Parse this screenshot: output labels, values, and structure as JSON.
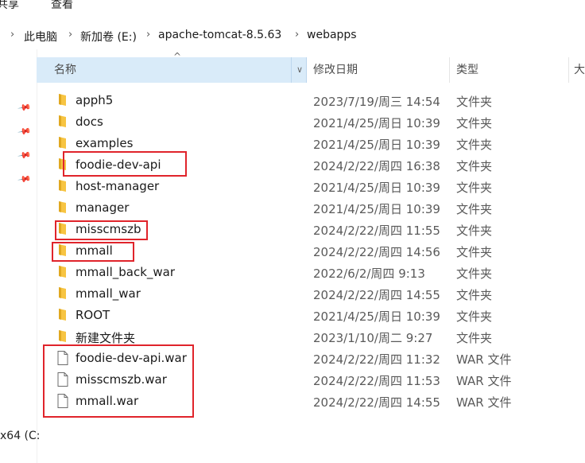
{
  "ribbon": {
    "tabs": [
      "共享",
      "查看"
    ]
  },
  "breadcrumb": {
    "items": [
      "此电脑",
      "新加卷 (E:)",
      "apache-tomcat-8.5.63",
      "webapps"
    ]
  },
  "nav": {
    "label": "x64 (C:"
  },
  "columns": {
    "name": "名称",
    "date": "修改日期",
    "type": "类型",
    "size": "大"
  },
  "files": [
    {
      "name": "apph5",
      "date": "2023/7/19/周三 14:54",
      "type": "文件夹",
      "kind": "folder"
    },
    {
      "name": "docs",
      "date": "2021/4/25/周日 10:39",
      "type": "文件夹",
      "kind": "folder"
    },
    {
      "name": "examples",
      "date": "2021/4/25/周日 10:39",
      "type": "文件夹",
      "kind": "folder"
    },
    {
      "name": "foodie-dev-api",
      "date": "2024/2/22/周四 16:38",
      "type": "文件夹",
      "kind": "folder"
    },
    {
      "name": "host-manager",
      "date": "2021/4/25/周日 10:39",
      "type": "文件夹",
      "kind": "folder"
    },
    {
      "name": "manager",
      "date": "2021/4/25/周日 10:39",
      "type": "文件夹",
      "kind": "folder"
    },
    {
      "name": "misscmszb",
      "date": "2024/2/22/周四 11:55",
      "type": "文件夹",
      "kind": "folder"
    },
    {
      "name": "mmall",
      "date": "2024/2/22/周四 14:56",
      "type": "文件夹",
      "kind": "folder"
    },
    {
      "name": "mmall_back_war",
      "date": "2022/6/2/周四 9:13",
      "type": "文件夹",
      "kind": "folder"
    },
    {
      "name": "mmall_war",
      "date": "2024/2/22/周四 14:55",
      "type": "文件夹",
      "kind": "folder"
    },
    {
      "name": "ROOT",
      "date": "2021/4/25/周日 10:39",
      "type": "文件夹",
      "kind": "folder"
    },
    {
      "name": "新建文件夹",
      "date": "2023/1/10/周二 9:27",
      "type": "文件夹",
      "kind": "folder"
    },
    {
      "name": "foodie-dev-api.war",
      "date": "2024/2/22/周四 11:32",
      "type": "WAR 文件",
      "kind": "file"
    },
    {
      "name": "misscmszb.war",
      "date": "2024/2/22/周四 11:53",
      "type": "WAR 文件",
      "kind": "file"
    },
    {
      "name": "mmall.war",
      "date": "2024/2/22/周四 14:55",
      "type": "WAR 文件",
      "kind": "file"
    }
  ],
  "icons": {
    "folder": "folder-icon",
    "file": "file-icon",
    "pin": "pin-icon",
    "chevron": "chevron-right-icon"
  },
  "colors": {
    "folder": "#f7c442",
    "selectedHeader": "#d9ebf9",
    "annotation": "#e0242b"
  }
}
